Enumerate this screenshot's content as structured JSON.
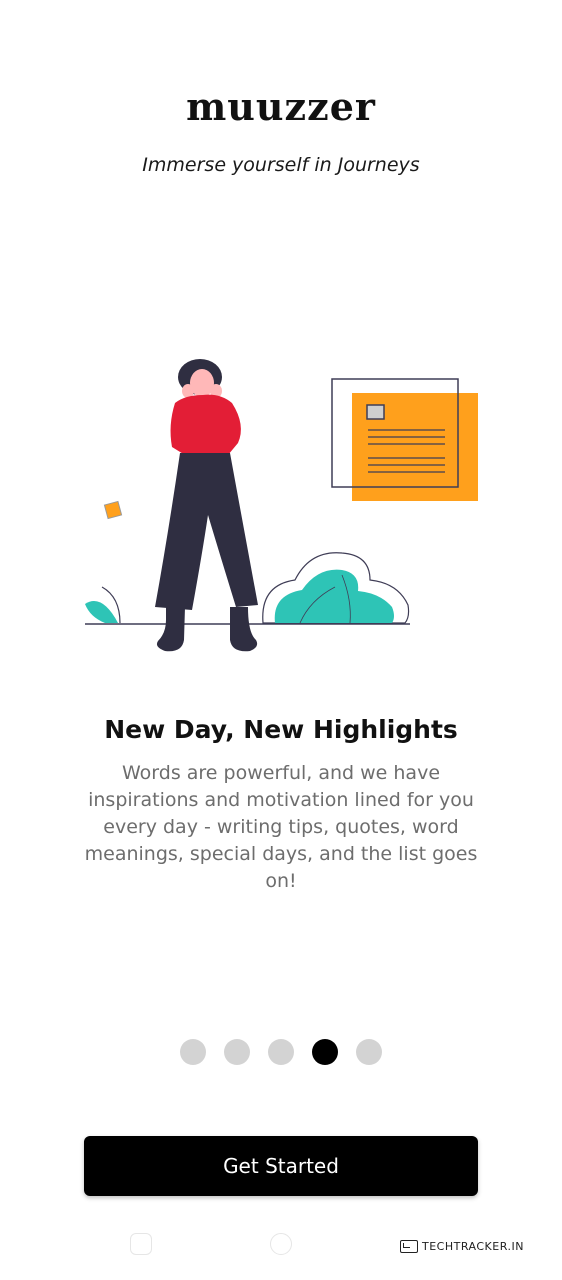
{
  "app": {
    "logo_text": "muuzzer",
    "tagline": "Immerse yourself in Journeys"
  },
  "illustration": {
    "icon": "woman-reading-illustration"
  },
  "onboarding": {
    "title": "New Day, New Highlights",
    "description": "Words are powerful, and we have inspirations and motivation lined for you every day - writing tips, quotes, word meanings, special days, and the list goes on!",
    "page_count": 5,
    "active_page": 4
  },
  "cta": {
    "label": "Get Started"
  },
  "watermark": {
    "text": "TECHTRACKER.IN"
  },
  "colors": {
    "primary": "#000000",
    "accent_orange": "#FFA01C",
    "accent_teal": "#2EC4B6",
    "shirt_red": "#E31E36",
    "dot_inactive": "#D3D3D3"
  }
}
